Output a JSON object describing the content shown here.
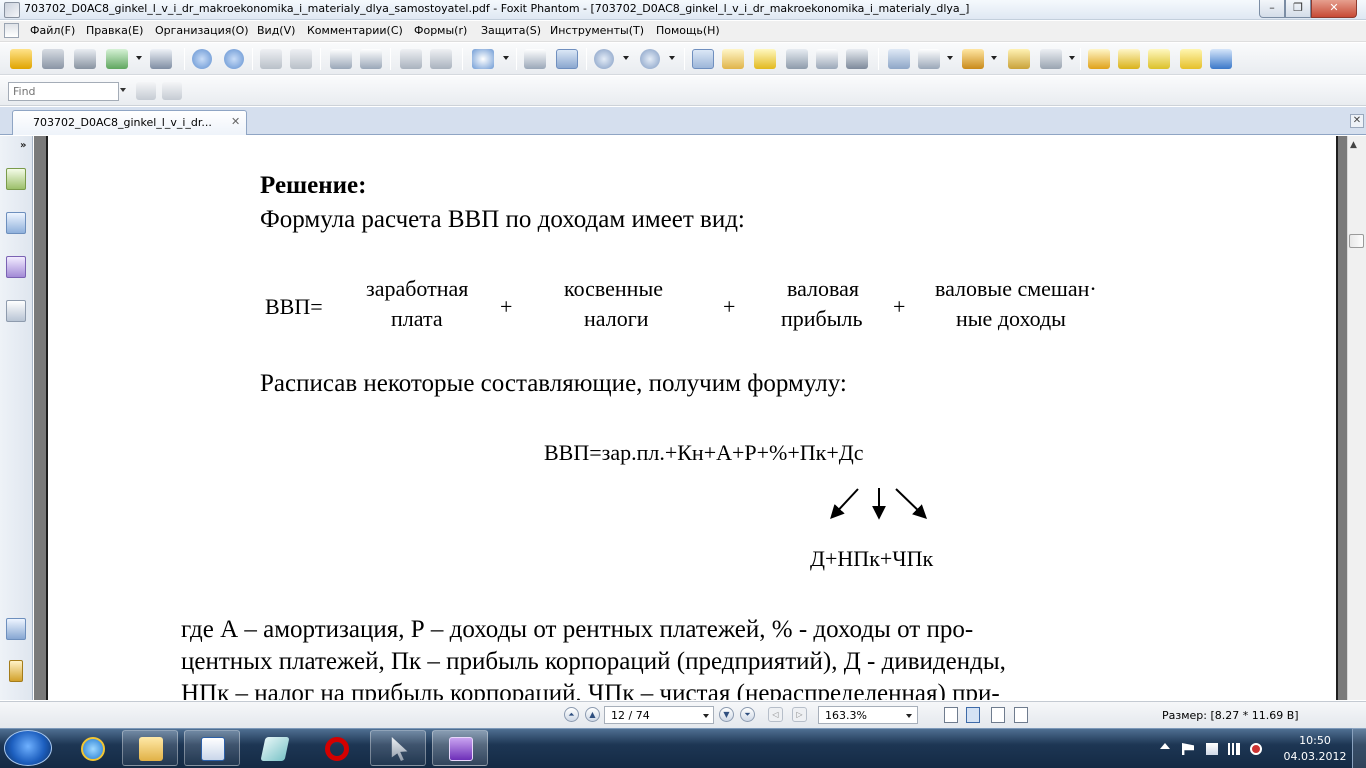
{
  "window": {
    "title": "703702_D0AC8_ginkel_l_v_i_dr_makroekonomika_i_materialy_dlya_samostoyatel.pdf - Foxit Phantom - [703702_D0AC8_ginkel_l_v_i_dr_makroekonomika_i_materialy_dlya_]",
    "min": "–",
    "max": "❐",
    "close": "✕"
  },
  "menu": [
    "Файл(F)",
    "Правка(E)",
    "Организация(O)",
    "Вид(V)",
    "Комментарии(C)",
    "Формы(r)",
    "Защита(S)",
    "Инструменты(T)",
    "Помощь(H)"
  ],
  "find": {
    "placeholder": "Find"
  },
  "tab": {
    "label": "703702_D0AC8_ginkel_l_v_i_dr...",
    "close": "✕",
    "close_all": "✕"
  },
  "panel": {
    "expand": "»"
  },
  "document": {
    "heading": "Решение:",
    "line1": "Формула расчета ВВП по доходам имеет вид:",
    "formula": {
      "lhs": "ВВП=",
      "t1a": "заработная",
      "t1b": "плата",
      "t2a": "косвенные",
      "t2b": "налоги",
      "t3a": "валовая",
      "t3b": "прибыль",
      "t4a": "валовые смешан·",
      "t4b": "ные доходы",
      "plus": "+"
    },
    "line2": "Расписав некоторые составляющие, получим формулу:",
    "formula2": "ВВП=зар.пл.+Кн+А+Р+%+Пк+Дс",
    "formula3": "Д+НПк+ЧПк",
    "para1": "где   А  –  амортизация,  Р  –  доходы  от  рентных  платежей,  %  -  доходы  от  про-",
    "para2": "центных платежей, Пк – прибыль корпораций (предприятий), Д - дивиденды,",
    "para3": "НПк – налог на прибыль корпораций, ЧПк – чистая (нераспределенная) при-"
  },
  "status": {
    "page": "12 / 74",
    "zoom": "163.3%",
    "page_size": "Размер: [8.27 * 11.69 В]"
  },
  "taskbar": {
    "time": "10:50",
    "date": "04.03.2012",
    "apps": [
      "ie-icon",
      "explorer-folder-icon",
      "word-icon",
      "app-icon",
      "opera-icon",
      "cursor-app-icon",
      "foxit-icon"
    ]
  },
  "colors": {
    "accent": "#2f6fc4",
    "tab_strip": "#d5dfee",
    "taskbar": "#1d3654"
  }
}
